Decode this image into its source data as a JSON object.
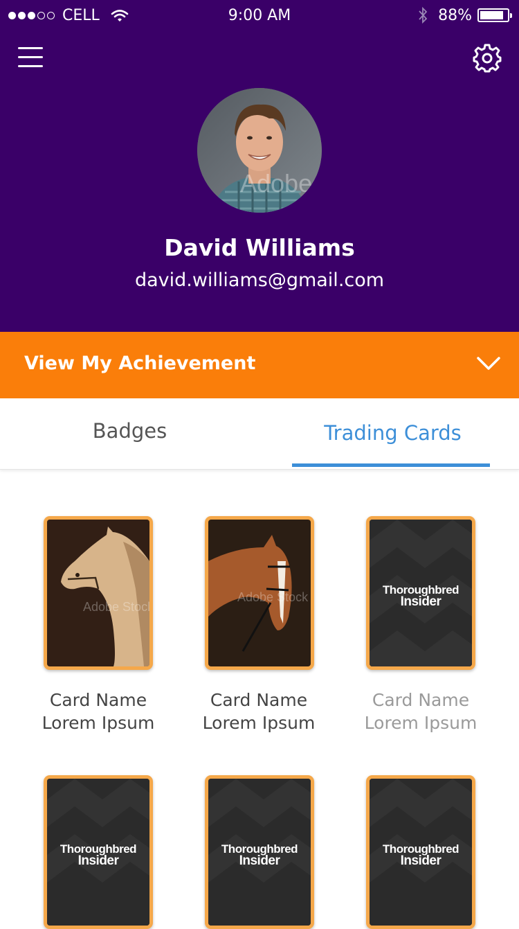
{
  "status_bar": {
    "carrier": "CELL",
    "time": "9:00 AM",
    "battery_percent": "88%",
    "battery_level": 0.88,
    "signal_bars_filled": 3,
    "signal_bars_total": 5
  },
  "header": {
    "background_color": "#3a0068",
    "menu_icon": "hamburger-menu-icon",
    "settings_icon": "gear-icon",
    "avatar_watermark": "Adobe"
  },
  "profile": {
    "name": "David Williams",
    "email": "david.williams@gmail.com"
  },
  "achievement": {
    "label": "View My Achievement",
    "color": "#fa7e0a",
    "icon": "chevron-down-icon"
  },
  "tabs": [
    {
      "label": "Badges",
      "active": false
    },
    {
      "label": "Trading Cards",
      "active": true,
      "color": "#3d8fd8"
    }
  ],
  "cards": [
    {
      "name_line1": "Card Name",
      "name_line2": "Lorem Ipsum",
      "image": "palomino-horse",
      "watermark": "Adobe Stock",
      "muted": false
    },
    {
      "name_line1": "Card Name",
      "name_line2": "Lorem Ipsum",
      "image": "chestnut-horse",
      "watermark": "Adobe Stock",
      "muted": false
    },
    {
      "name_line1": "Card Name",
      "name_line2": "Lorem Ipsum",
      "image": "thoroughbred-insider-logo",
      "logo_line1": "Thoroughbred",
      "logo_line2": "Insider",
      "muted": true
    },
    {
      "image": "thoroughbred-insider-logo",
      "logo_line1": "Thoroughbred",
      "logo_line2": "Insider"
    },
    {
      "image": "thoroughbred-insider-logo",
      "logo_line1": "Thoroughbred",
      "logo_line2": "Insider"
    },
    {
      "image": "thoroughbred-insider-logo",
      "logo_line1": "Thoroughbred",
      "logo_line2": "Insider"
    }
  ]
}
